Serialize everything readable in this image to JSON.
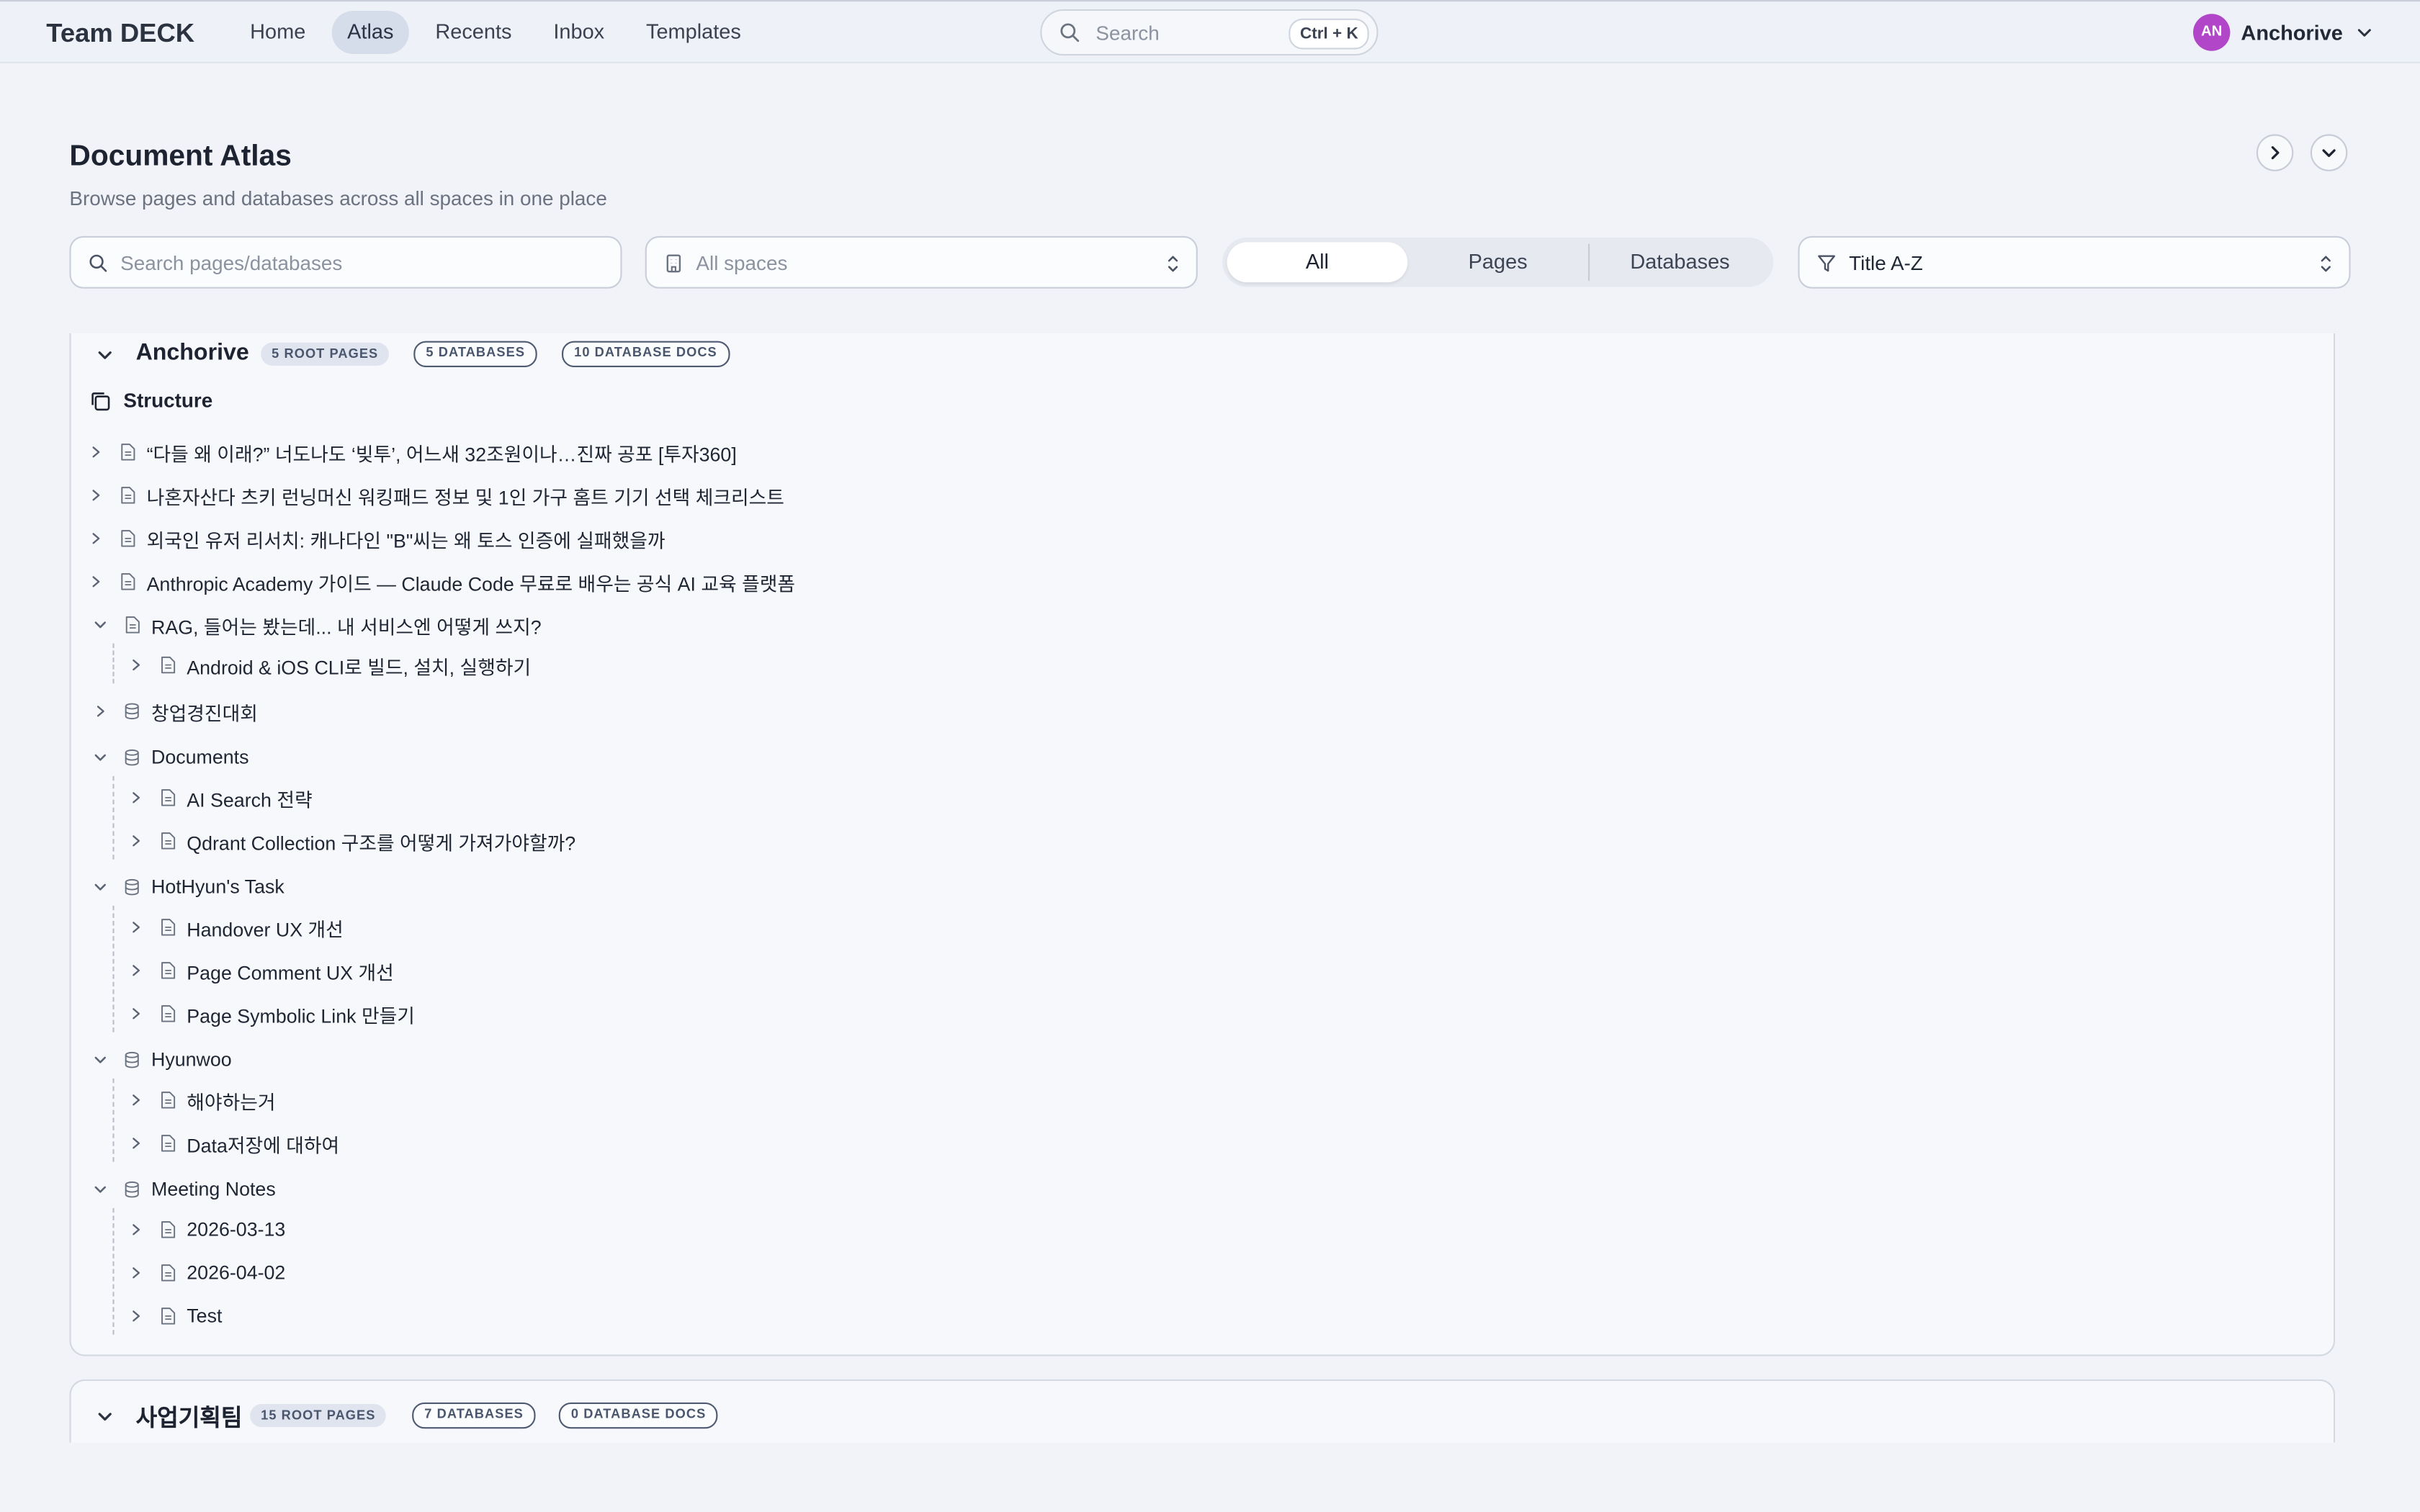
{
  "app": {
    "brand": "Team DECK"
  },
  "nav": {
    "items": [
      "Home",
      "Atlas",
      "Recents",
      "Inbox",
      "Templates"
    ],
    "active": "Atlas"
  },
  "global_search": {
    "placeholder": "Search",
    "shortcut": "Ctrl + K"
  },
  "user": {
    "initials": "AN",
    "name": "Anchorive",
    "avatar_color": "#b146c9"
  },
  "page": {
    "title": "Document Atlas",
    "subtitle": "Browse pages and databases across all spaces in one place"
  },
  "toolbar": {
    "search_placeholder": "Search pages/databases",
    "space_placeholder": "All spaces",
    "segments": [
      "All",
      "Pages",
      "Databases"
    ],
    "active_segment": "All",
    "sort_value": "Title A-Z"
  },
  "spaces": [
    {
      "name": "Anchorive",
      "badges": [
        "5 ROOT PAGES",
        "5 DATABASES",
        "10 DATABASE DOCS"
      ],
      "section_label": "Structure",
      "tree": [
        {
          "type": "page",
          "label": "“다들 왜 이래?” 너도나도 ‘빚투’, 어느새 32조원이나…진짜 공포 [투자360]"
        },
        {
          "type": "page",
          "label": "나혼자산다 츠키 런닝머신 워킹패드 정보 및 1인 가구 홈트 기기 선택 체크리스트"
        },
        {
          "type": "page",
          "label": "외국인 유저 리서치: 캐나다인 \"B\"씨는 왜 토스 인증에 실패했을까"
        },
        {
          "type": "page",
          "label": "Anthropic Academy 가이드 — Claude Code 무료로 배우는 공식 AI 교육 플랫폼"
        },
        {
          "type": "page",
          "label": "RAG, 들어는 봤는데... 내 서비스엔 어떻게 쓰지?",
          "expanded": true,
          "children": [
            {
              "type": "page",
              "label": "Android & iOS CLI로 빌드, 설치, 실행하기"
            }
          ]
        },
        {
          "type": "database",
          "label": "창업경진대회"
        },
        {
          "type": "database",
          "label": "Documents",
          "expanded": true,
          "children": [
            {
              "type": "page",
              "label": "AI Search 전략"
            },
            {
              "type": "page",
              "label": "Qdrant Collection 구조를 어떻게 가져가야할까?"
            }
          ]
        },
        {
          "type": "database",
          "label": "HotHyun's Task",
          "expanded": true,
          "children": [
            {
              "type": "page",
              "label": "Handover UX 개선"
            },
            {
              "type": "page",
              "label": "Page Comment UX 개선"
            },
            {
              "type": "page",
              "label": "Page Symbolic Link 만들기"
            }
          ]
        },
        {
          "type": "database",
          "label": "Hyunwoo",
          "expanded": true,
          "children": [
            {
              "type": "page",
              "label": "해야하는거"
            },
            {
              "type": "page",
              "label": "Data저장에 대하여"
            }
          ]
        },
        {
          "type": "database",
          "label": "Meeting Notes",
          "expanded": true,
          "children": [
            {
              "type": "page",
              "label": "2026-03-13"
            },
            {
              "type": "page",
              "label": "2026-04-02"
            },
            {
              "type": "page",
              "label": "Test"
            }
          ]
        }
      ]
    },
    {
      "name": "사업기획팀",
      "badges": [
        "15 ROOT PAGES",
        "7 DATABASES",
        "0 DATABASE DOCS"
      ]
    }
  ]
}
